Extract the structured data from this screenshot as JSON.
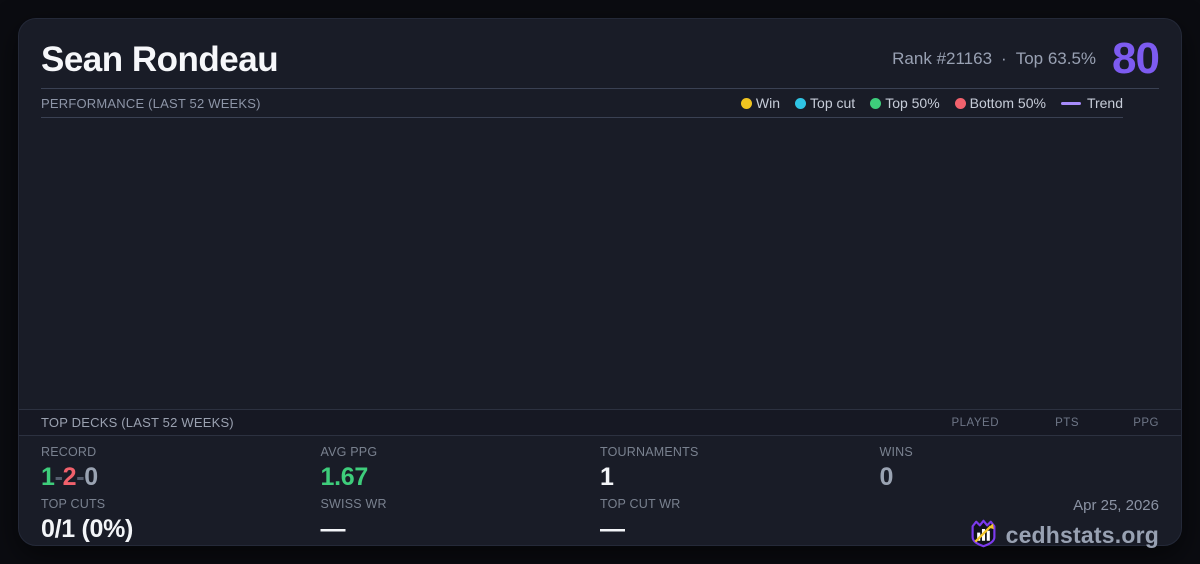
{
  "player": {
    "name": "Sean Rondeau",
    "rank_text": "Rank #21163",
    "separator": "·",
    "top_percent_text": "Top 63.5%",
    "score": "80"
  },
  "performance": {
    "title": "PERFORMANCE (LAST 52 WEEKS)",
    "legend": [
      {
        "label": "Win",
        "color": "#f0c420",
        "shape": "dot"
      },
      {
        "label": "Top cut",
        "color": "#2fc4e4",
        "shape": "dot"
      },
      {
        "label": "Top 50%",
        "color": "#3ecd7b",
        "shape": "dot"
      },
      {
        "label": "Bottom 50%",
        "color": "#f1616c",
        "shape": "dot"
      },
      {
        "label": "Trend",
        "color": "#a78bfa",
        "shape": "line"
      }
    ]
  },
  "chart_data": {
    "type": "scatter",
    "title": "PERFORMANCE (LAST 52 WEEKS)",
    "x": [],
    "series": [],
    "note": "chart plot area is empty — no result points or trend line rendered"
  },
  "top_decks": {
    "title": "TOP DECKS (LAST 52 WEEKS)",
    "columns": [
      "PLAYED",
      "PTS",
      "PPG"
    ],
    "rows": []
  },
  "stats": {
    "record": {
      "label": "RECORD",
      "wins": "1",
      "losses": "2",
      "draws": "0",
      "separator": "-"
    },
    "avg_ppg": {
      "label": "AVG PPG",
      "value": "1.67"
    },
    "tournaments": {
      "label": "TOURNAMENTS",
      "value": "1"
    },
    "wins": {
      "label": "WINS",
      "value": "0"
    },
    "top_cuts": {
      "label": "TOP CUTS",
      "value": "0/1 (0%)"
    },
    "swiss_wr": {
      "label": "SWISS WR",
      "value": "—"
    },
    "top_cut_wr": {
      "label": "TOP CUT WR",
      "value": "—"
    }
  },
  "footer": {
    "date": "Apr 25, 2026",
    "brand": "cedhstats.org"
  },
  "theme": {
    "page_bg": "#0b0c11",
    "card_bg": "#191c27",
    "divider": "#3a4153",
    "score_color": "#7d5bf0",
    "win_color": "#3ecd7b",
    "loss_color": "#f1616c",
    "draw_color": "#9aa3b2",
    "separator_color": "#555d6e",
    "ppg_color": "#3ecd7b",
    "logo_purple": "#7c3aed",
    "logo_gold": "#f3c629"
  }
}
